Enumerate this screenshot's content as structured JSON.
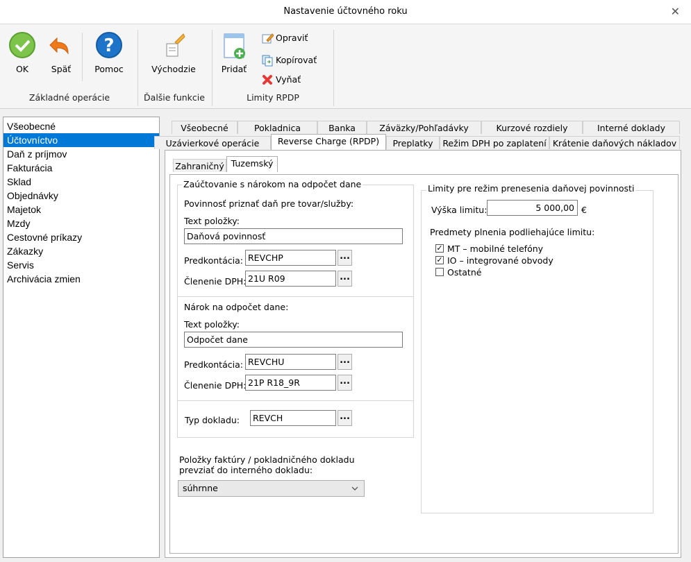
{
  "window": {
    "title": "Nastavenie účtovného roku",
    "close_symbol": "✕"
  },
  "ribbon": {
    "ok": "OK",
    "back": "Späť",
    "help": "Pomoc",
    "defaults": "Východzie",
    "add": "Pridať",
    "edit": "Opraviť",
    "copy": "Kopírovať",
    "remove": "Vyňať",
    "groups": {
      "basic": "Základné operácie",
      "more": "Ďalšie funkcie",
      "limits": "Limity RPDP"
    }
  },
  "sidebar": {
    "items": [
      "Všeobecné",
      "Účtovníctvo",
      "Daň z príjmov",
      "Fakturácia",
      "Sklad",
      "Objednávky",
      "Majetok",
      "Mzdy",
      "Cestovné príkazy",
      "Zákazky",
      "Servis",
      "Archivácia zmien"
    ],
    "selected": "Účtovníctvo"
  },
  "tabs_row1": [
    "Všeobecné",
    "Pokladnica",
    "Banka",
    "Záväzky/Pohľadávky",
    "Kurzové rozdiely",
    "Interné doklady"
  ],
  "tabs_row2": [
    "Uzávierkové operácie",
    "Reverse Charge (RPDP)",
    "Preplatky",
    "Režim DPH po zaplatení",
    "Krátenie daňových nákladov"
  ],
  "subtabs": [
    "Zahraničný",
    "Tuzemský"
  ],
  "left_group": {
    "legend": "Zaúčtovanie s nárokom na odpočet dane",
    "section1_title": "Povinnosť priznať daň pre tovar/služby:",
    "text_label": "Text položky:",
    "text1_value": "Daňová povinnosť",
    "predkontacia_label": "Predkontácia:",
    "predkontacia1": "REVCHP",
    "clenenie_label": "Členenie DPH:",
    "clenenie1": "21U R09",
    "section2_title": "Nárok na odpočet dane:",
    "text2_value": "Odpočet dane",
    "predkontacia2": "REVCHU",
    "clenenie2": "21P R18_9R",
    "typ_label": "Typ dokladu:",
    "typ_value": "REVCH",
    "dots": "..."
  },
  "invoice_items": {
    "label_line1": "Položky faktúry / pokladničného dokladu",
    "label_line2": "prevziať do interného dokladu:",
    "value": "súhrnne"
  },
  "right_group": {
    "legend": "Limity pre režim prenesenia daňovej povinnosti",
    "limit_label": "Výška limitu:",
    "limit_value": "5 000,00",
    "currency": "€",
    "subjects_label": "Predmety plnenia podliehajúce limitu:",
    "checkboxes": [
      {
        "label": "MT – mobilné telefóny",
        "checked": true
      },
      {
        "label": "IO – integrované obvody",
        "checked": true
      },
      {
        "label": "Ostatné",
        "checked": false
      }
    ]
  }
}
